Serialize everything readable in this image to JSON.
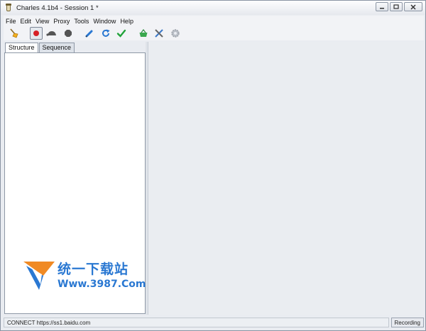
{
  "window": {
    "title": "Charles 4.1b4 - Session 1 *"
  },
  "menu": [
    "File",
    "Edit",
    "View",
    "Proxy",
    "Tools",
    "Window",
    "Help"
  ],
  "toolbar": [
    {
      "icon": "broom-icon"
    },
    {
      "icon": "record-icon",
      "active": true
    },
    {
      "icon": "throttle-turtle-icon"
    },
    {
      "icon": "stop-hexagon-icon"
    },
    {
      "icon": "pen-edit-icon"
    },
    {
      "icon": "refresh-icon"
    },
    {
      "icon": "check-icon"
    },
    {
      "icon": "basket-icon"
    },
    {
      "icon": "tools-icon"
    },
    {
      "icon": "settings-gear-icon"
    }
  ],
  "tabs": [
    "Structure",
    "Sequence"
  ],
  "status": {
    "message": "CONNECT https://ss1.baidu.com",
    "badge": "Recording"
  },
  "watermark": {
    "text": "统一下载站",
    "url": "Www.3987.Com"
  },
  "colors": {
    "accent": "#2a78d2",
    "record": "#d61f26",
    "check": "#22a33a"
  }
}
